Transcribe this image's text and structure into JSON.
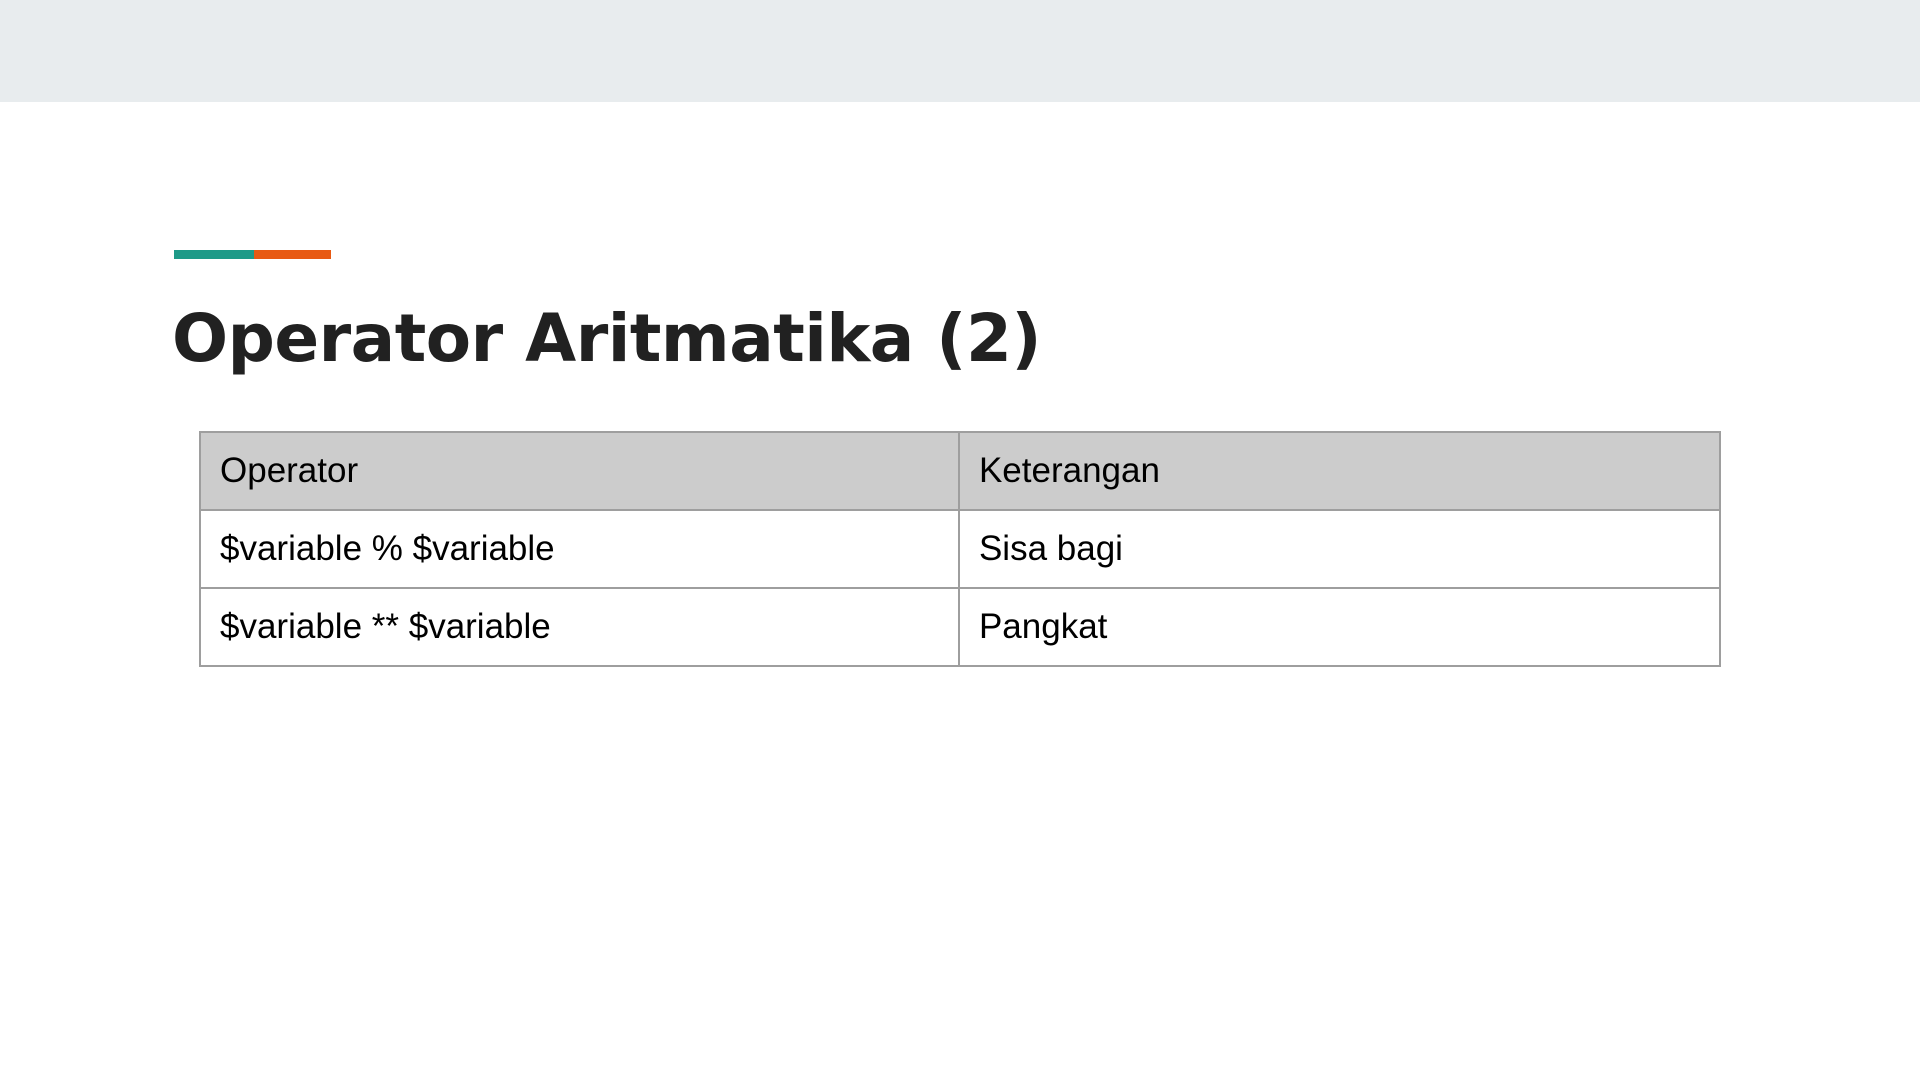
{
  "colors": {
    "top_band": "#e8ecee",
    "accent_teal": "#1e9a88",
    "accent_orange": "#e85a13",
    "header_fill": "#cccccc"
  },
  "slide": {
    "title": "Operator Aritmatika (2)"
  },
  "table": {
    "headers": [
      "Operator",
      "Keterangan"
    ],
    "rows": [
      [
        "$variable % $variable",
        "Sisa bagi"
      ],
      [
        "$variable ** $variable",
        "Pangkat"
      ]
    ]
  }
}
